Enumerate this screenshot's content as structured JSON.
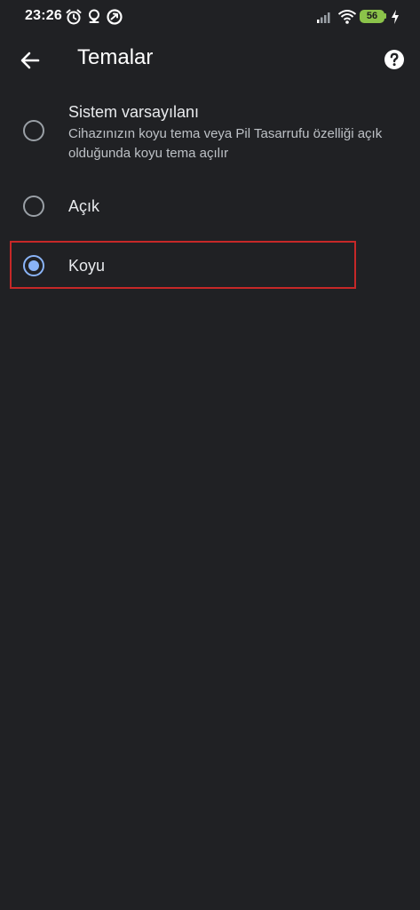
{
  "status_bar": {
    "time": "23:26",
    "icons": [
      "alarm-icon",
      "location-icon",
      "sync-icon",
      "signal-icon",
      "wifi-icon",
      "charging-icon"
    ],
    "battery": "56",
    "battery_color": "#8bc34a"
  },
  "app_bar": {
    "title": "Temalar",
    "back_icon": "arrow-back-icon",
    "help_icon": "help-icon"
  },
  "options": [
    {
      "title": "Sistem varsayılanı",
      "description": "Cihazınızın koyu tema veya Pil Tasarrufu özelliği açık olduğunda koyu tema açılır",
      "selected": false
    },
    {
      "title": "Açık",
      "selected": false
    },
    {
      "title": "Koyu",
      "selected": true
    }
  ],
  "colors": {
    "background": "#202124",
    "accent": "#8ab4f8",
    "highlight": "#c62828"
  }
}
